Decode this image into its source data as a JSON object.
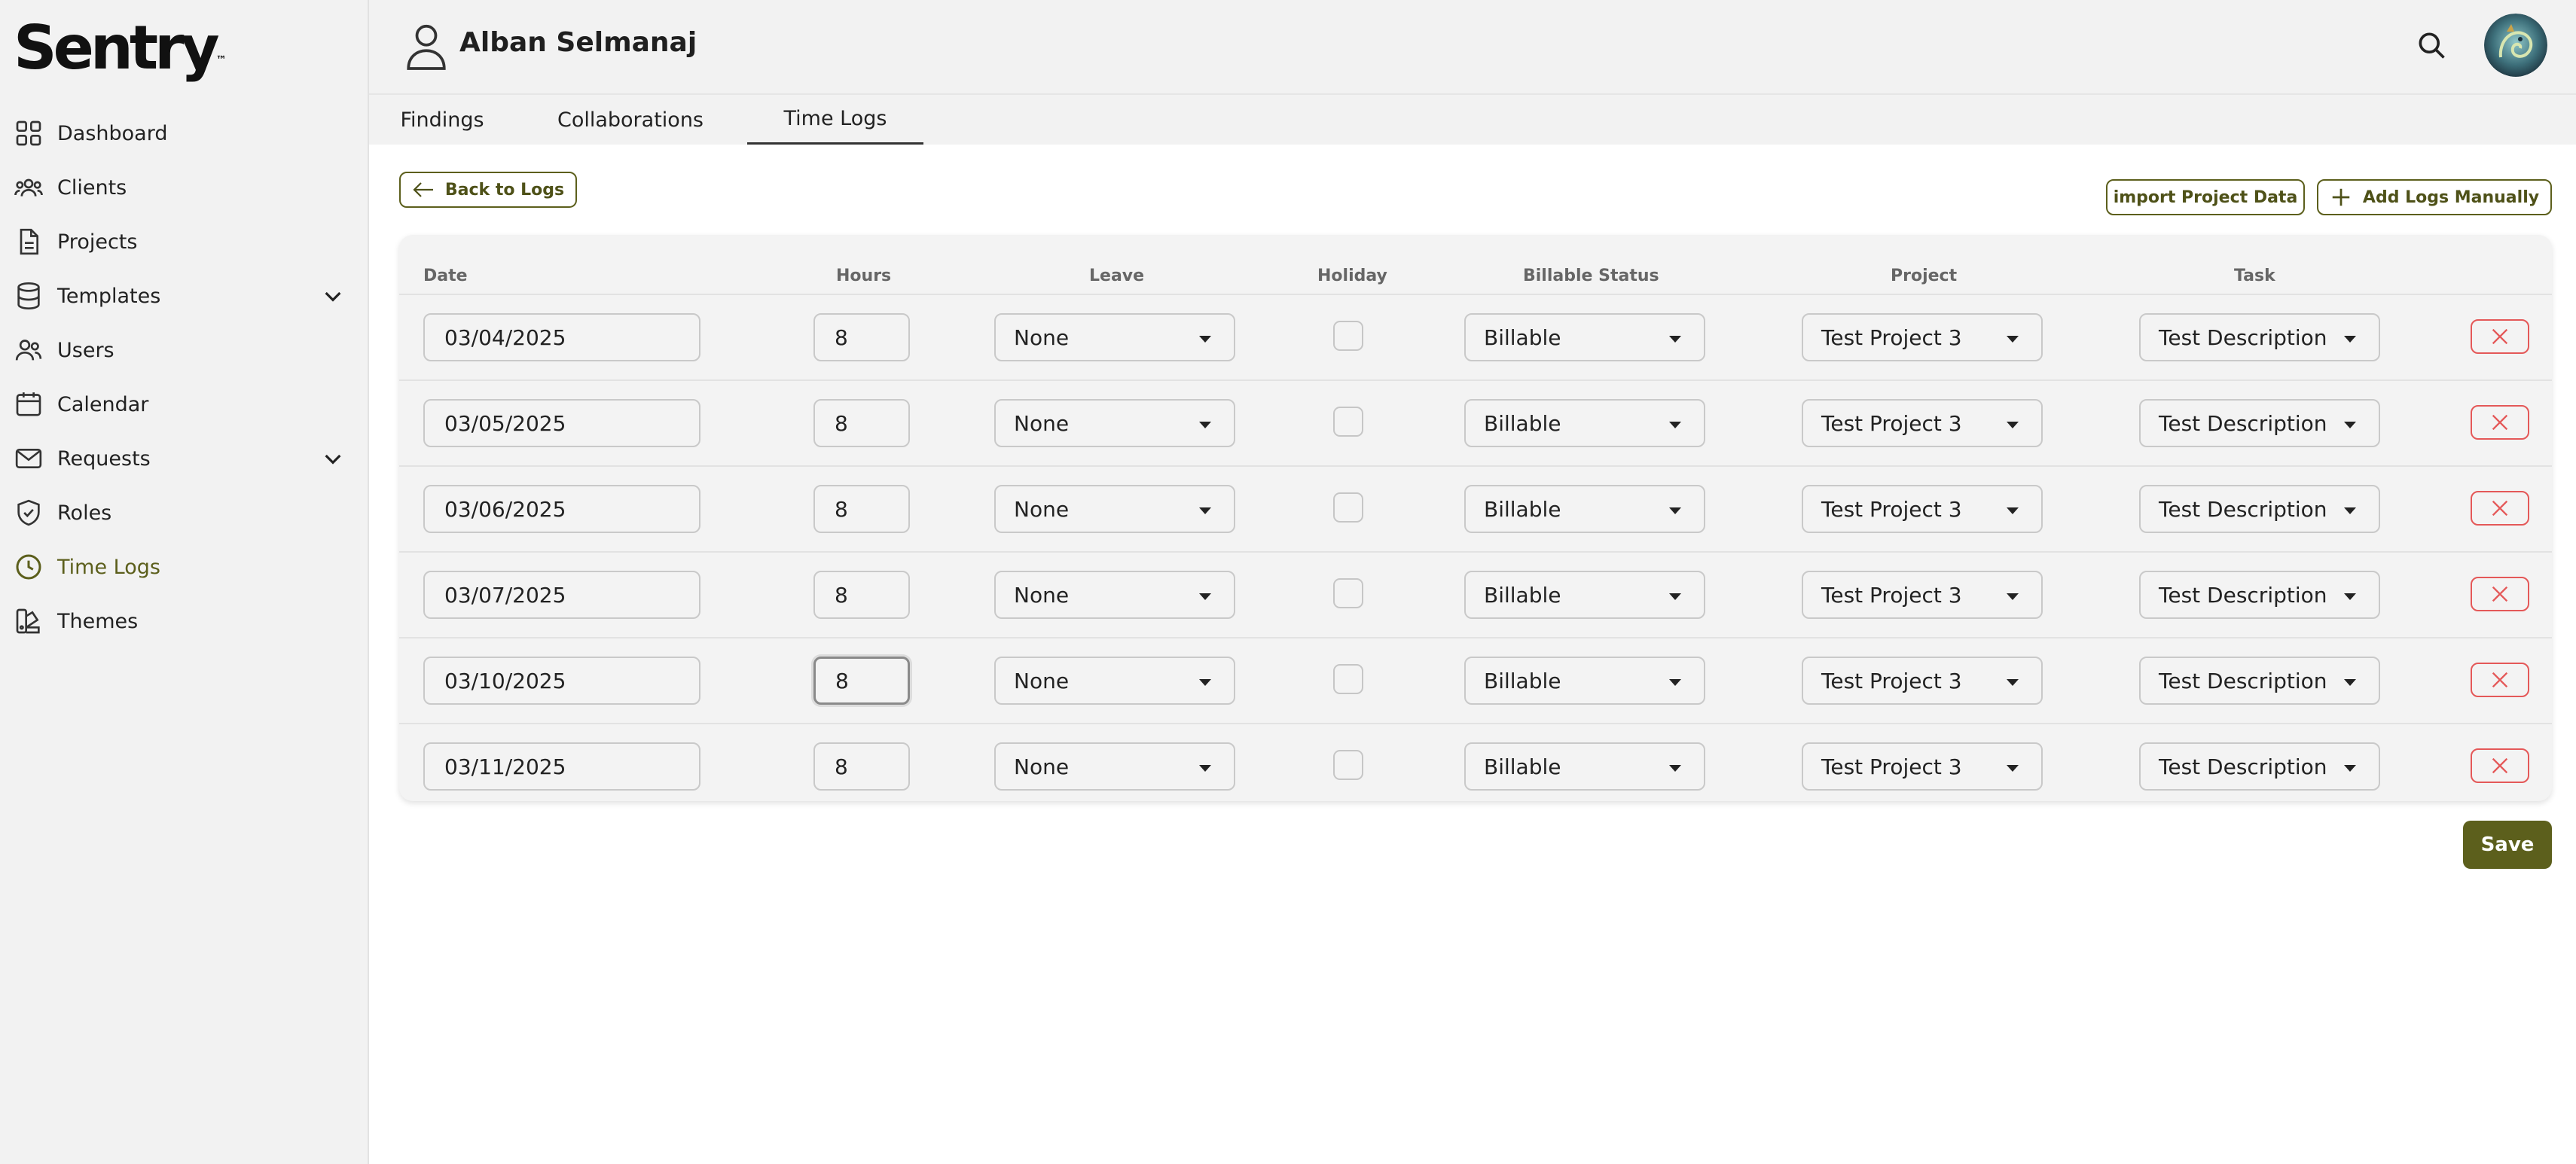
{
  "app": {
    "logo_text": "Sentry"
  },
  "sidebar": {
    "items": [
      {
        "label": "Dashboard",
        "icon": "grid-icon",
        "active": false
      },
      {
        "label": "Clients",
        "icon": "users-group-icon",
        "active": false
      },
      {
        "label": "Projects",
        "icon": "document-icon",
        "active": false
      },
      {
        "label": "Templates",
        "icon": "database-icon",
        "active": false,
        "expandable": true
      },
      {
        "label": "Users",
        "icon": "users-icon",
        "active": false
      },
      {
        "label": "Calendar",
        "icon": "calendar-icon",
        "active": false
      },
      {
        "label": "Requests",
        "icon": "mail-icon",
        "active": false,
        "expandable": true
      },
      {
        "label": "Roles",
        "icon": "shield-check-icon",
        "active": false
      },
      {
        "label": "Time Logs",
        "icon": "clock-icon",
        "active": true
      },
      {
        "label": "Themes",
        "icon": "palette-icon",
        "active": false
      }
    ]
  },
  "header": {
    "title": "Alban Selmanaj"
  },
  "tabs": [
    {
      "label": "Findings",
      "active": false
    },
    {
      "label": "Collaborations",
      "active": false
    },
    {
      "label": "Time Logs",
      "active": true
    }
  ],
  "toolbar": {
    "back_label": "Back to Logs",
    "import_label": "import Project Data",
    "add_label": "Add Logs Manually"
  },
  "table": {
    "headers": {
      "date": "Date",
      "hours": "Hours",
      "leave": "Leave",
      "holiday": "Holiday",
      "billable": "Billable Status",
      "project": "Project",
      "task": "Task"
    },
    "rows": [
      {
        "date": "03/04/2025",
        "hours": "8",
        "leave": "None",
        "holiday": false,
        "billable": "Billable",
        "project": "Test Project 3",
        "task": "Test Description"
      },
      {
        "date": "03/05/2025",
        "hours": "8",
        "leave": "None",
        "holiday": false,
        "billable": "Billable",
        "project": "Test Project 3",
        "task": "Test Description"
      },
      {
        "date": "03/06/2025",
        "hours": "8",
        "leave": "None",
        "holiday": false,
        "billable": "Billable",
        "project": "Test Project 3",
        "task": "Test Description"
      },
      {
        "date": "03/07/2025",
        "hours": "8",
        "leave": "None",
        "holiday": false,
        "billable": "Billable",
        "project": "Test Project 3",
        "task": "Test Description"
      },
      {
        "date": "03/10/2025",
        "hours": "8",
        "leave": "None",
        "holiday": false,
        "billable": "Billable",
        "project": "Test Project 3",
        "task": "Test Description"
      },
      {
        "date": "03/11/2025",
        "hours": "8",
        "leave": "None",
        "holiday": false,
        "billable": "Billable",
        "project": "Test Project 3",
        "task": "Test Description"
      }
    ]
  },
  "footer": {
    "save_label": "Save"
  },
  "colors": {
    "accent": "#5c5f1c",
    "danger": "#e45858",
    "background": "#f2f2f2"
  }
}
